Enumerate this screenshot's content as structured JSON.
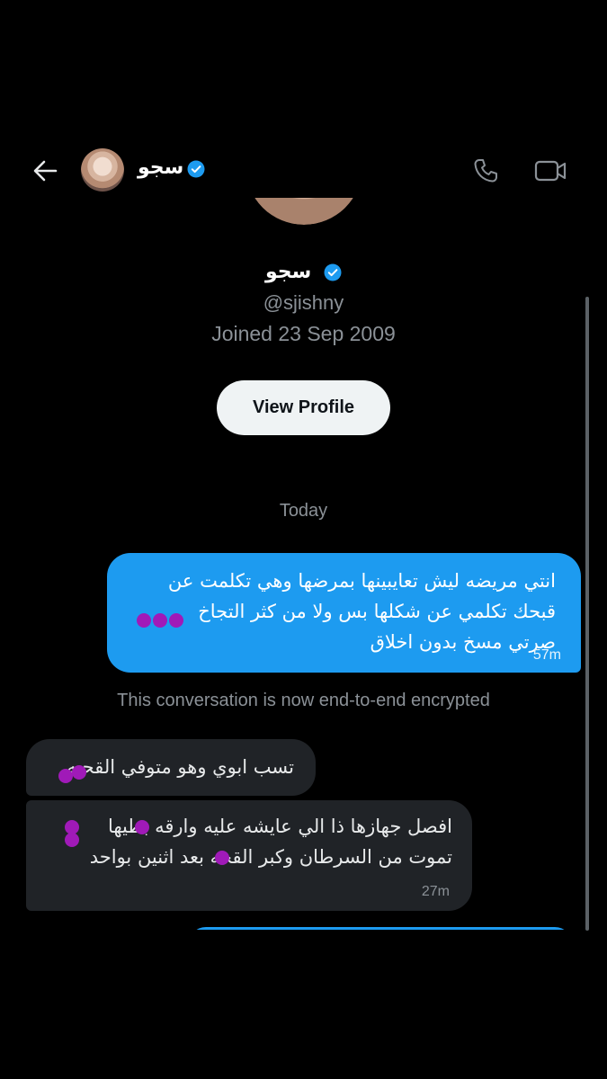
{
  "header": {
    "name": "سجو",
    "verified_color": "#1d9bf0",
    "back_icon": "back-arrow-icon",
    "call_icon": "phone-icon",
    "video_icon": "video-camera-icon"
  },
  "profile": {
    "name": "سجو",
    "handle": "@sjishny",
    "joined": "Joined 23 Sep 2009",
    "view_profile_label": "View Profile"
  },
  "day_label": "Today",
  "outgoing_message": {
    "lines": [
      "انتي مريضه ليش تعايبينها بمرضها وهي تكلمت عن",
      "قبحك تكلمي عن شكلها بس ولا من كثر التجاخ",
      "صرتي مسخ بدون اخلاق"
    ],
    "time": "57m"
  },
  "encrypted_note": "This conversation is now end-to-end encrypted",
  "incoming_messages": [
    {
      "lines": [
        "تسب ابوي وهو متوفي القحبه"
      ]
    },
    {
      "lines": [
        "افصل جهازها ذا الي عايشه عليه وارقه بطيها",
        "تموت من السرطان وكبر القحه بعد اثنين بواحد"
      ],
      "time": "27m"
    }
  ],
  "colors": {
    "background": "#000000",
    "outgoing_bubble": "#1d9bf0",
    "incoming_bubble": "#202327",
    "muted_text": "#8b9197",
    "redaction": "#a01ab8"
  }
}
